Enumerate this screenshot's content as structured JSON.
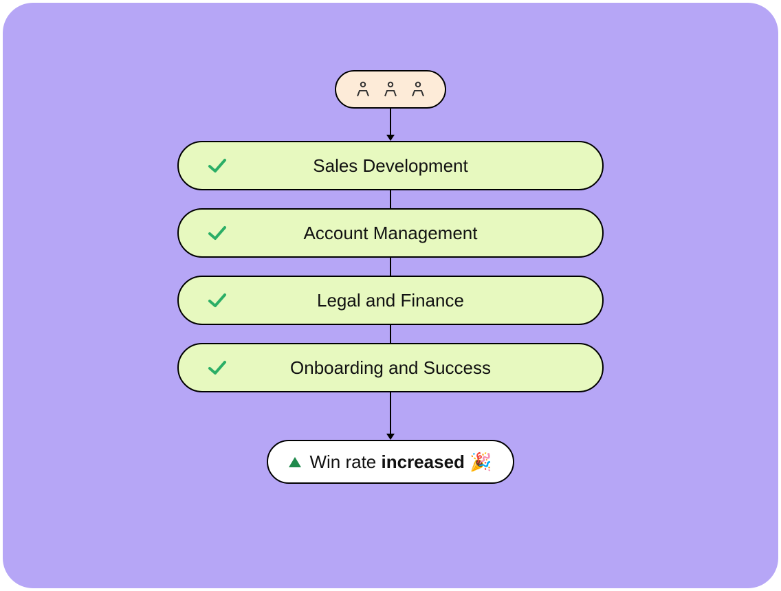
{
  "colors": {
    "background": "#B6A6F6",
    "teamPill": "#FDEBD8",
    "stagePill": "#E7F9BF",
    "resultPill": "#FFFFFF",
    "checkmark": "#2BAE66",
    "upTriangle": "#1F8A4C",
    "border": "#000000"
  },
  "team": {
    "icon": "person-icon",
    "count": 3
  },
  "stages": [
    {
      "label": "Sales Development",
      "checked": true
    },
    {
      "label": "Account Management",
      "checked": true
    },
    {
      "label": "Legal and Finance",
      "checked": true
    },
    {
      "label": "Onboarding and Success",
      "checked": true
    }
  ],
  "result": {
    "prefix": "Win rate ",
    "emphasis": "increased",
    "emoji": "🎉"
  }
}
